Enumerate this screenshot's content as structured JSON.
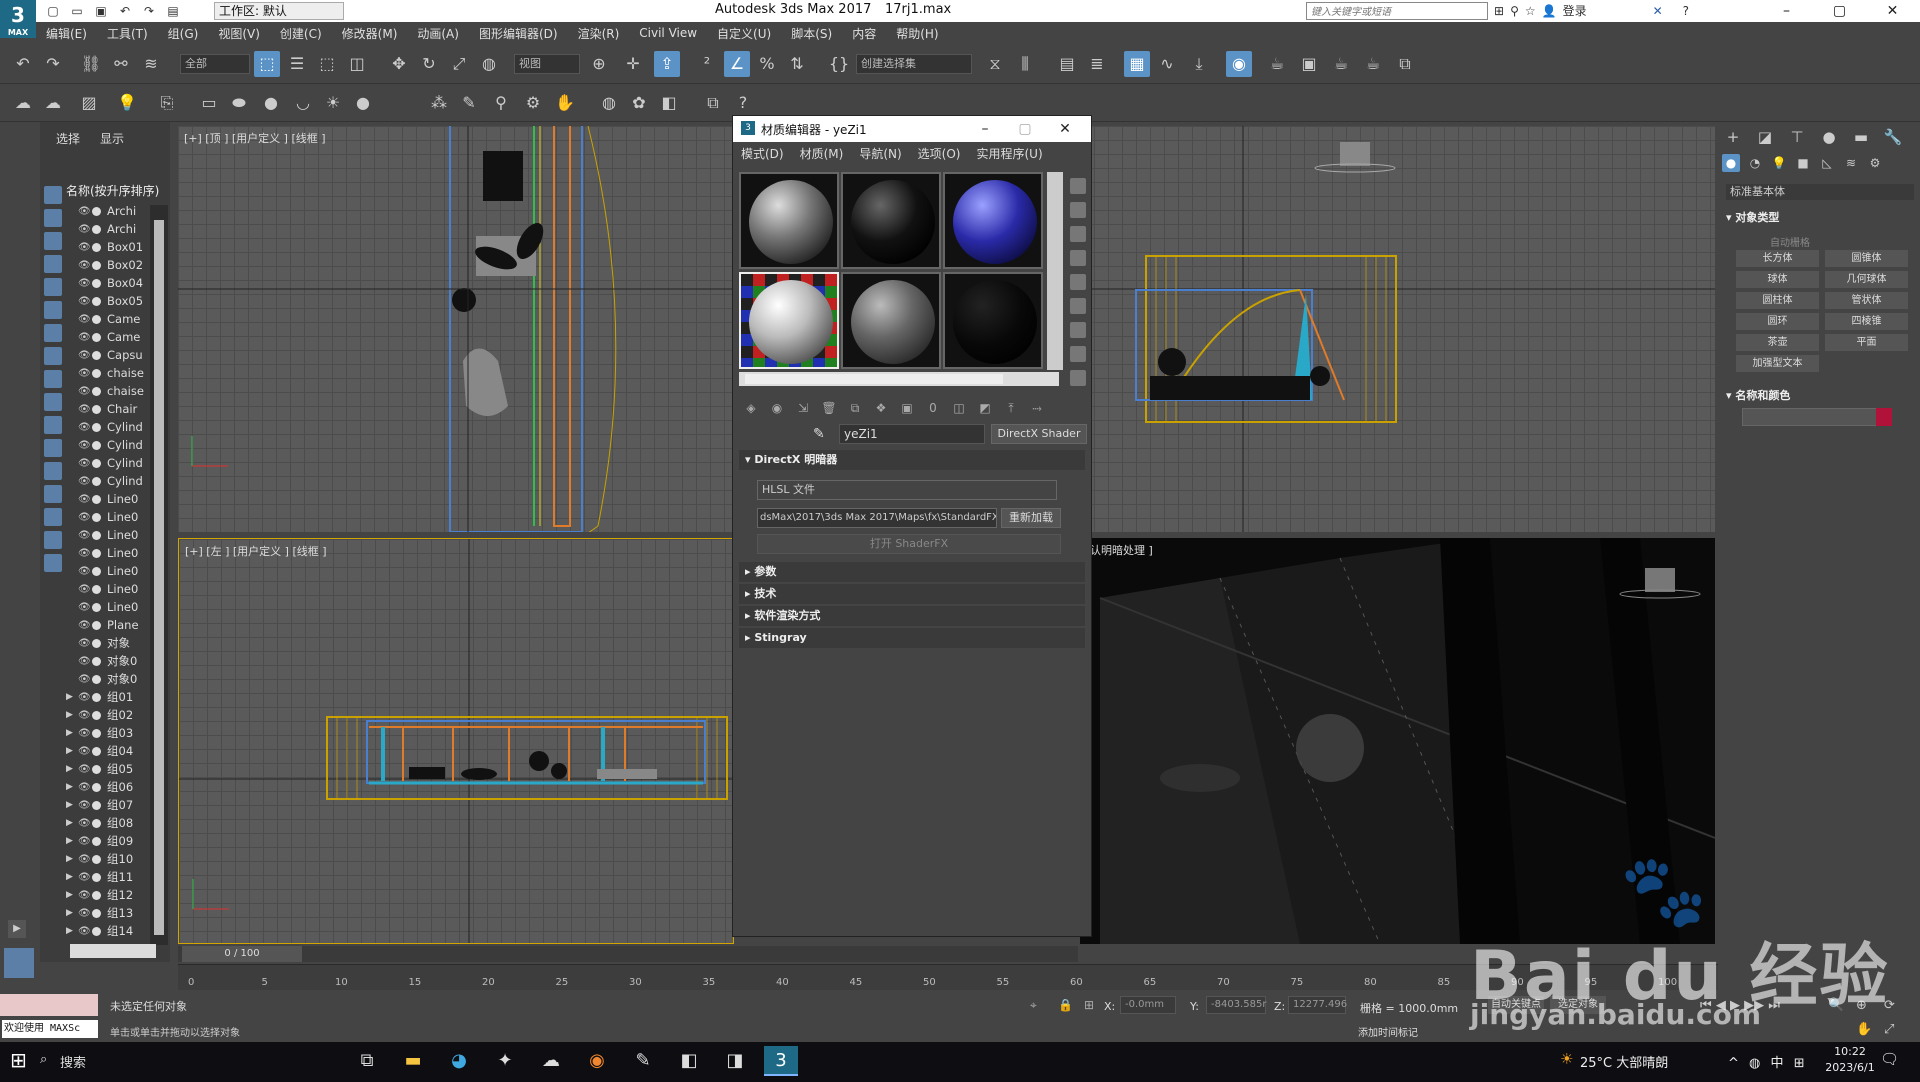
{
  "titlebar": {
    "logo_text": "3",
    "logo_sub": "MAX",
    "workspace": "工作区: 默认",
    "app_title": "Autodesk 3ds Max 2017",
    "file_name": "17rj1.max",
    "search_placeholder": "键入关键字或短语",
    "login": "登录"
  },
  "menu": [
    "编辑(E)",
    "工具(T)",
    "组(G)",
    "视图(V)",
    "创建(C)",
    "修改器(M)",
    "动画(A)",
    "图形编辑器(D)",
    "渲染(R)",
    "Civil View",
    "自定义(U)",
    "脚本(S)",
    "内容",
    "帮助(H)"
  ],
  "toolbar": {
    "filter_select": "全部",
    "ref_coord": "视图",
    "selection_set": "创建选择集"
  },
  "scene_explorer": {
    "tabs": [
      "选择",
      "显示"
    ],
    "header": "名称(按升序排序)",
    "items": [
      {
        "name": "Archi",
        "group": false
      },
      {
        "name": "Archi",
        "group": false
      },
      {
        "name": "Box01",
        "group": false
      },
      {
        "name": "Box02",
        "group": false
      },
      {
        "name": "Box04",
        "group": false
      },
      {
        "name": "Box05",
        "group": false
      },
      {
        "name": "Came",
        "group": false
      },
      {
        "name": "Came",
        "group": false
      },
      {
        "name": "Capsu",
        "group": false
      },
      {
        "name": "chaise",
        "group": false
      },
      {
        "name": "chaise",
        "group": false
      },
      {
        "name": "Chair",
        "group": false
      },
      {
        "name": "Cylind",
        "group": false
      },
      {
        "name": "Cylind",
        "group": false
      },
      {
        "name": "Cylind",
        "group": false
      },
      {
        "name": "Cylind",
        "group": false
      },
      {
        "name": "Line0",
        "group": false
      },
      {
        "name": "Line0",
        "group": false
      },
      {
        "name": "Line0",
        "group": false
      },
      {
        "name": "Line0",
        "group": false
      },
      {
        "name": "Line0",
        "group": false
      },
      {
        "name": "Line0",
        "group": false
      },
      {
        "name": "Line0",
        "group": false
      },
      {
        "name": "Plane",
        "group": false
      },
      {
        "name": "对象",
        "group": false
      },
      {
        "name": "对象0",
        "group": false
      },
      {
        "name": "对象0",
        "group": false
      },
      {
        "name": "组01",
        "group": true
      },
      {
        "name": "组02",
        "group": true
      },
      {
        "name": "组03",
        "group": true
      },
      {
        "name": "组04",
        "group": true
      },
      {
        "name": "组05",
        "group": true
      },
      {
        "name": "组06",
        "group": true
      },
      {
        "name": "组07",
        "group": true
      },
      {
        "name": "组08",
        "group": true
      },
      {
        "name": "组09",
        "group": true
      },
      {
        "name": "组10",
        "group": true
      },
      {
        "name": "组11",
        "group": true
      },
      {
        "name": "组12",
        "group": true
      },
      {
        "name": "组13",
        "group": true
      },
      {
        "name": "组14",
        "group": true
      }
    ]
  },
  "viewports": {
    "top_label": "[+] [顶 ] [用户定义 ] [线框 ]",
    "left_label": "[+] [左 ] [用户定义 ] [线框 ]",
    "persp_label": "认明暗处理 ]"
  },
  "material_editor": {
    "title": "材质编辑器 - yeZi1",
    "menu": [
      "模式(D)",
      "材质(M)",
      "导航(N)",
      "选项(O)",
      "实用程序(U)"
    ],
    "material_name": "yeZi1",
    "material_type": "DirectX Shader",
    "rollout_directx": "DirectX 明暗器",
    "hlsl": "HLSL 文件",
    "path": "dsMax\\2017\\3ds Max 2017\\Maps\\fx\\StandardFX11",
    "reload": "重新加载",
    "open_shaderfx": "打开 ShaderFX",
    "rollouts": [
      "参数",
      "技术",
      "软件渲染方式",
      "Stingray"
    ]
  },
  "command_panel": {
    "category": "标准基本体",
    "object_type": "对象类型",
    "autogrid": "自动栅格",
    "buttons": [
      "长方体",
      "圆锥体",
      "球体",
      "几何球体",
      "圆柱体",
      "管状体",
      "圆环",
      "四棱锥",
      "茶壶",
      "平面",
      "加强型文本"
    ],
    "name_color": "名称和颜色",
    "object_color": "#b0123a"
  },
  "timeline": {
    "frame": "0 / 100",
    "ticks": [
      "0",
      "5",
      "10",
      "15",
      "20",
      "25",
      "30",
      "35",
      "40",
      "45",
      "50",
      "55",
      "60",
      "65",
      "70",
      "75",
      "80",
      "85",
      "90",
      "95",
      "100"
    ]
  },
  "status": {
    "welcome": "欢迎使用 MAXSc",
    "msg1": "未选定任何对象",
    "msg2": "单击或单击并拖动以选择对象",
    "x_label": "X:",
    "x_value": "-0.0mm",
    "y_label": "Y:",
    "y_value": "-8403.585r",
    "z_label": "Z:",
    "z_value": "12277.496",
    "grid": "栅格 = 1000.0mm",
    "add_time": "添加时间标记",
    "auto_key": "自动关键点",
    "set_key": "选定对象"
  },
  "taskbar": {
    "search": "搜索",
    "weather": "25°C 大部晴朗",
    "tray_lang": "中",
    "time": "10:22",
    "date": "2023/6/1"
  },
  "watermark": {
    "text": "Bai du 经验",
    "url": "jingyan.baidu.com"
  }
}
